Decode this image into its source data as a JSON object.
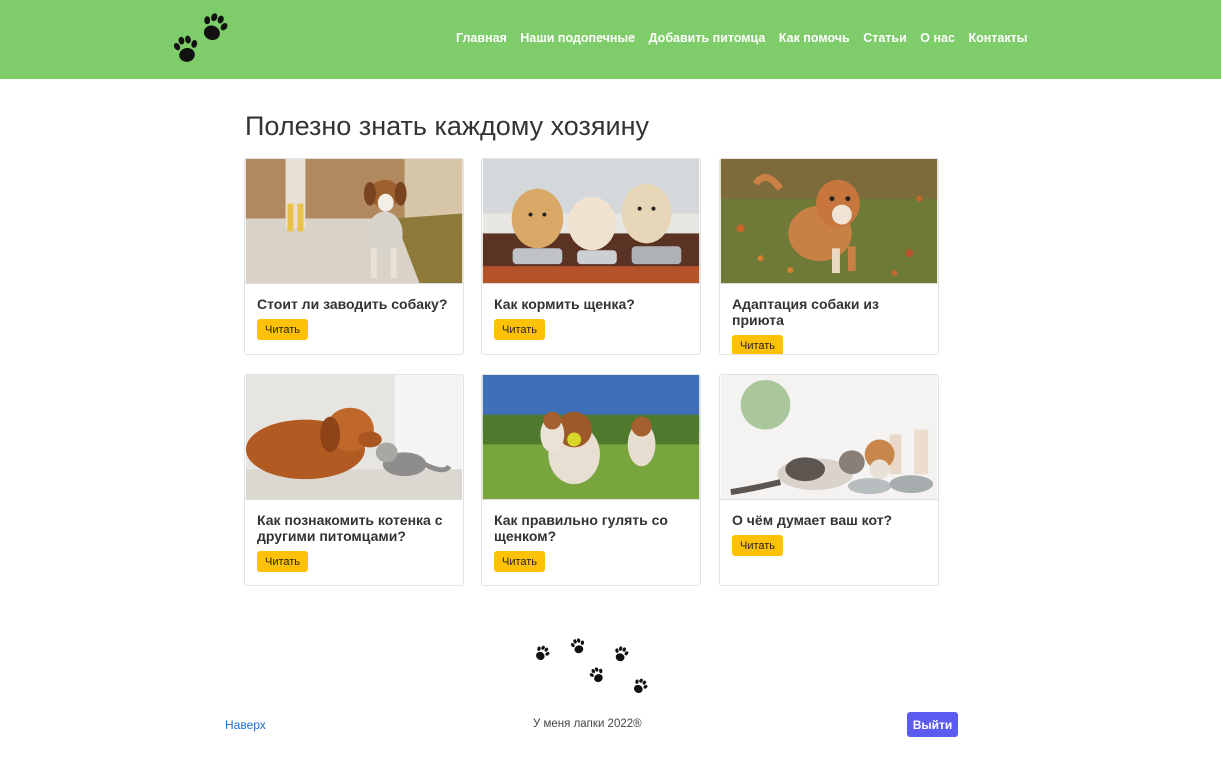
{
  "colors": {
    "header_bg": "#7fcc6a",
    "read_button": "#ffc107",
    "logout_button": "#5b5bf0",
    "link": "#1a6fd1"
  },
  "header": {
    "logo_icon": "paw-prints-icon",
    "nav": [
      {
        "label": "Главная"
      },
      {
        "label": "Наши подопечные"
      },
      {
        "label": "Добавить питомца"
      },
      {
        "label": "Как помочь"
      },
      {
        "label": "Статьи"
      },
      {
        "label": "О нас"
      },
      {
        "label": "Контакты"
      }
    ]
  },
  "main": {
    "title": "Полезно знать каждому хозяину",
    "articles": [
      {
        "title": "Стоит ли заводить собаку?",
        "button": "Читать",
        "image": "beagle-on-walk-photo"
      },
      {
        "title": "Как кормить щенка?",
        "button": "Читать",
        "image": "puppies-at-bowls-photo"
      },
      {
        "title": "Адаптация собаки из приюта",
        "button": "Читать",
        "image": "puppy-on-grass-photo"
      },
      {
        "title": "Как познакомить котенка с другими питомцами?",
        "button": "Читать",
        "image": "dog-and-kitten-photo"
      },
      {
        "title": "Как правильно гулять со щенком?",
        "button": "Читать",
        "image": "beagles-running-photo"
      },
      {
        "title": "О чём думает ваш кот?",
        "button": "Читать",
        "image": "kittens-at-bowls-photo"
      }
    ]
  },
  "footer": {
    "paws_icon": "paw-trail-icon",
    "top_link": "Наверх",
    "copyright": "У меня лапки 2022®",
    "logout": "Выйти"
  }
}
